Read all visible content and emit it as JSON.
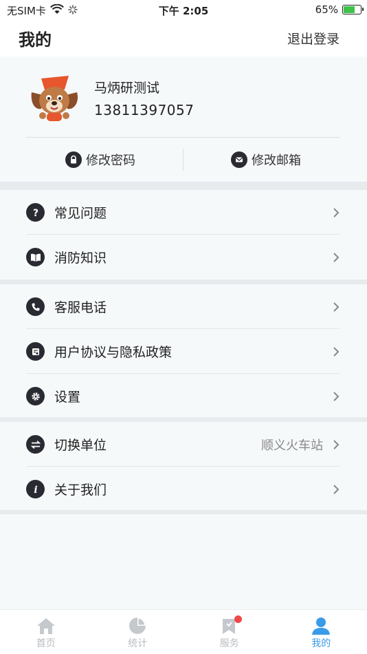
{
  "status_bar": {
    "carrier": "无SIM卡",
    "time": "下午 2:05",
    "battery": "65%"
  },
  "nav": {
    "title": "我的",
    "logout_label": "退出登录"
  },
  "profile": {
    "name": "马炳研测试",
    "phone": "13811397057",
    "change_password": "修改密码",
    "change_email": "修改邮箱"
  },
  "menu": {
    "faq": "常见问题",
    "fire_knowledge": "消防知识",
    "service_phone": "客服电话",
    "agreement": "用户协议与隐私政策",
    "settings": "设置",
    "switch_unit": "切换单位",
    "switch_unit_value": "顺义火车站",
    "about": "关于我们"
  },
  "tabbar": {
    "home": "首页",
    "stats": "统计",
    "service": "服务",
    "mine": "我的",
    "active_color": "#3a9be8",
    "inactive_color": "#b8bcc0"
  }
}
